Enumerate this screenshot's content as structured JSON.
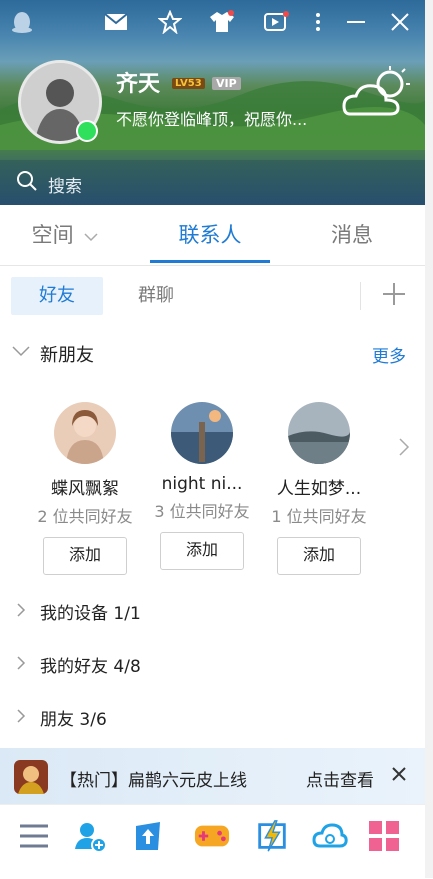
{
  "profile": {
    "nickname": "齐天",
    "level_badge": "LV53",
    "vip_badge": "VIP",
    "signature": "不愿你登临峰顶，祝愿你..."
  },
  "search": {
    "placeholder": "搜索"
  },
  "tabs": [
    {
      "label": "空间",
      "active": false
    },
    {
      "label": "联系人",
      "active": true
    },
    {
      "label": "消息",
      "active": false
    }
  ],
  "subtabs": [
    {
      "label": "好友",
      "active": true
    },
    {
      "label": "群聊",
      "active": false
    }
  ],
  "new_friends": {
    "title": "新朋友",
    "more_label": "更多",
    "people": [
      {
        "name": "蝶风飘絮",
        "mutual": "2 位共同好友",
        "button": "添加"
      },
      {
        "name": "night ni...",
        "mutual": "3 位共同好友",
        "button": "添加"
      },
      {
        "name": "人生如梦...",
        "mutual": "1 位共同好友",
        "button": "添加"
      }
    ]
  },
  "groups": [
    {
      "label": "我的设备  1/1"
    },
    {
      "label": "我的好友  4/8"
    },
    {
      "label": "朋友  3/6"
    }
  ],
  "banner": {
    "text": "【热门】扁鹊六元皮上线",
    "link": "点击查看"
  },
  "colors": {
    "accent": "#1f7bd4",
    "online": "#2ee05c",
    "text": "#222222",
    "muted": "#8a8a8a"
  },
  "toolbar_icons": [
    "menu-icon",
    "add-friend-icon",
    "file-transfer-icon",
    "game-center-icon",
    "kandian-icon",
    "weiyun-cloud-icon",
    "apps-grid-icon"
  ]
}
